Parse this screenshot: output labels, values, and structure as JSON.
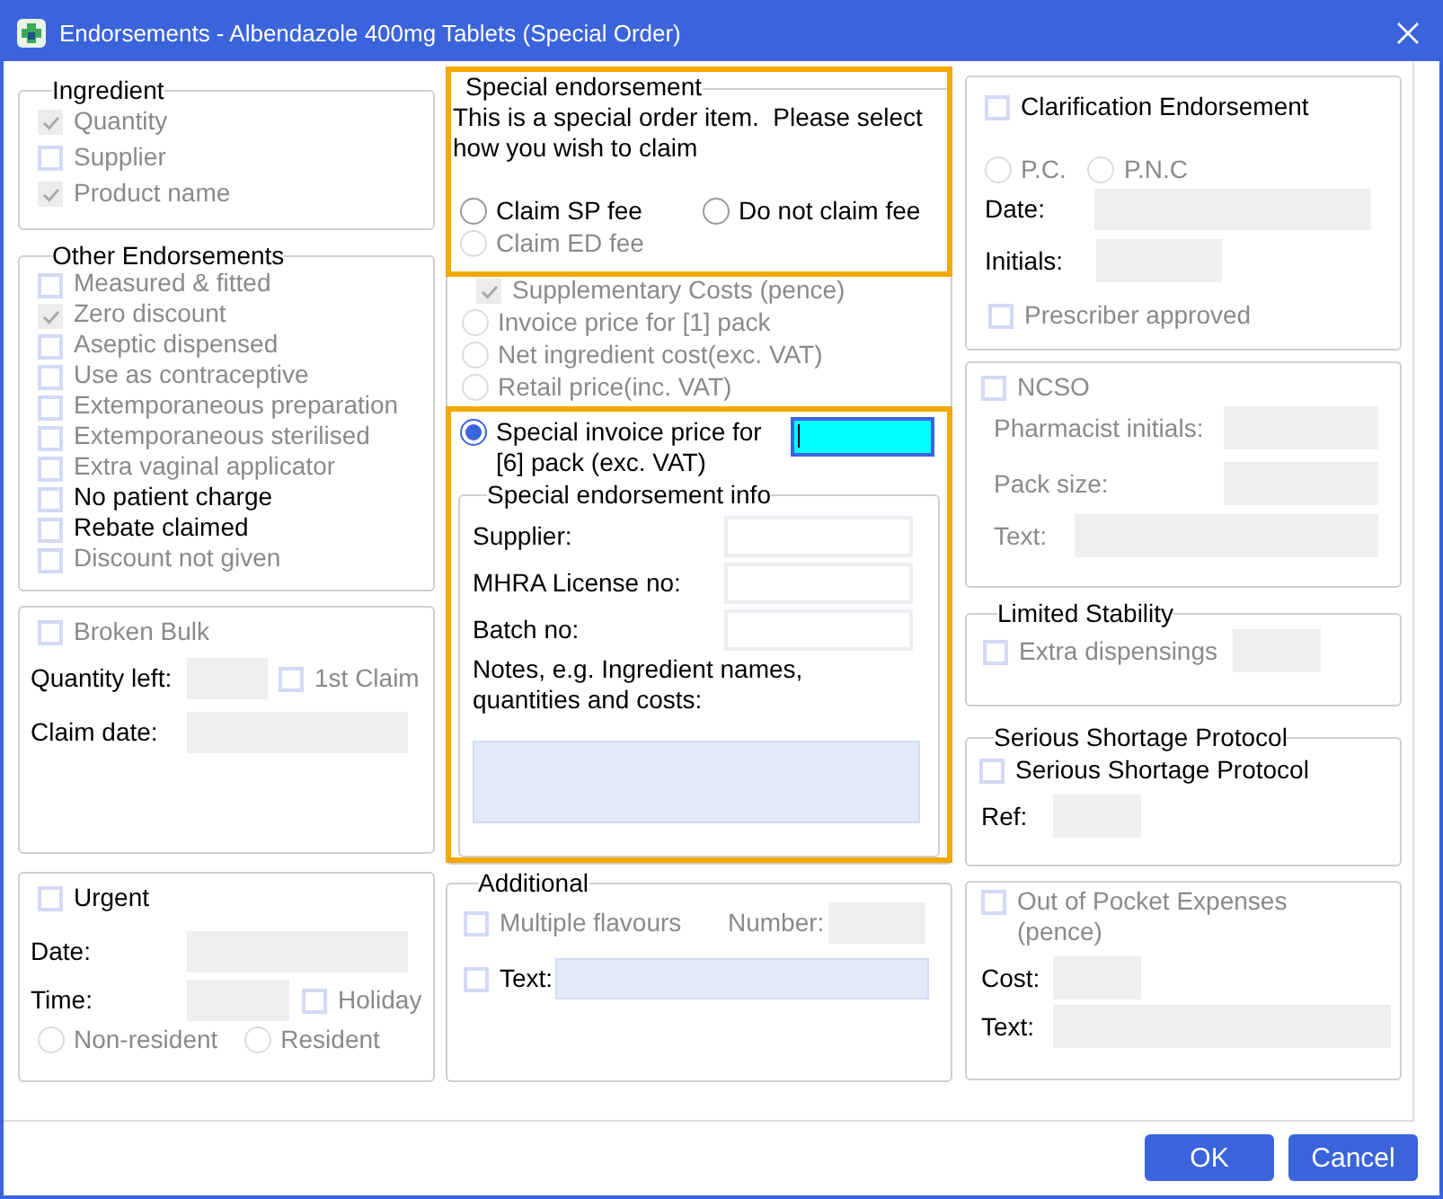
{
  "window": {
    "title": "Endorsements - Albendazole 400mg Tablets (Special Order)"
  },
  "ingredient": {
    "legend": "Ingredient",
    "options": [
      {
        "label": "Quantity",
        "checked": true,
        "disabled": true
      },
      {
        "label": "Supplier",
        "checked": false,
        "disabled": true
      },
      {
        "label": "Product name",
        "checked": true,
        "disabled": true
      }
    ]
  },
  "other_endorsements": {
    "legend": "Other Endorsements",
    "options": [
      {
        "label": "Measured & fitted",
        "checked": false,
        "disabled": true
      },
      {
        "label": "Zero discount",
        "checked": true,
        "disabled": true
      },
      {
        "label": "Aseptic dispensed",
        "checked": false,
        "disabled": true
      },
      {
        "label": "Use as contraceptive",
        "checked": false,
        "disabled": true
      },
      {
        "label": "Extemporaneous preparation",
        "checked": false,
        "disabled": true
      },
      {
        "label": "Extemporaneous sterilised",
        "checked": false,
        "disabled": true
      },
      {
        "label": "Extra vaginal applicator",
        "checked": false,
        "disabled": true
      },
      {
        "label": "No patient charge",
        "checked": false,
        "disabled": false
      },
      {
        "label": "Rebate claimed",
        "checked": false,
        "disabled": false
      },
      {
        "label": "Discount not given",
        "checked": false,
        "disabled": true
      }
    ]
  },
  "broken_bulk": {
    "checkbox": {
      "label": "Broken Bulk",
      "checked": false,
      "disabled": true
    },
    "quantity_left": {
      "label": "Quantity left:",
      "dimmed": false,
      "disabled": true
    },
    "first_claim": {
      "label": "1st Claim",
      "checked": false,
      "disabled": true
    },
    "claim_date": {
      "label": "Claim date:",
      "dimmed": false,
      "disabled": true
    }
  },
  "urgent": {
    "checkbox": {
      "label": "Urgent",
      "checked": false,
      "disabled": false
    },
    "date": {
      "label": "Date:",
      "dimmed": false,
      "disabled": true
    },
    "time": {
      "label": "Time:",
      "dimmed": false,
      "disabled": true
    },
    "holiday": {
      "label": "Holiday",
      "checked": false,
      "disabled": true
    },
    "residency": [
      {
        "label": "Non-resident",
        "selected": false,
        "disabled": true
      },
      {
        "label": "Resident",
        "selected": false,
        "disabled": true
      }
    ]
  },
  "special_endorsement": {
    "legend": "Special endorsement",
    "highlighted": true,
    "message": "This is a special order item.  Please select how you wish to claim",
    "options": [
      {
        "label": "Claim SP fee",
        "selected": false,
        "disabled": false
      },
      {
        "label": "Do not claim fee",
        "selected": false,
        "disabled": false
      },
      {
        "label": "Claim ED fee",
        "selected": false,
        "disabled": true
      }
    ]
  },
  "pricing": {
    "supplementary_costs": {
      "label": "Supplementary Costs (pence)",
      "checked": true,
      "disabled": true
    },
    "options": [
      {
        "label": "Invoice price for [1] pack",
        "selected": false,
        "disabled": true
      },
      {
        "label": "Net ingredient cost(exc. VAT)",
        "selected": false,
        "disabled": true
      },
      {
        "label": "Retail price(inc. VAT)",
        "selected": false,
        "disabled": true
      }
    ],
    "special_invoice": {
      "highlighted": true,
      "option": {
        "label": "Special invoice price for [6] pack (exc. VAT)",
        "selected": true,
        "disabled": false
      },
      "price_field": {
        "disabled": false,
        "focused": true
      },
      "info": {
        "legend": "Special endorsement info",
        "fields": [
          {
            "label": "Supplier:",
            "dimmed": false,
            "disabled": false,
            "read_only": true
          },
          {
            "label": "MHRA License no:",
            "dimmed": false,
            "disabled": false,
            "read_only": true
          },
          {
            "label": "Batch no:",
            "dimmed": false,
            "disabled": false,
            "read_only": true
          }
        ],
        "notes": {
          "label": "Notes, e.g. Ingredient names, quantities and costs:",
          "dimmed": false,
          "disabled": false,
          "read_only": false
        }
      }
    }
  },
  "additional": {
    "legend": "Additional",
    "multiple_flavours": {
      "label": "Multiple flavours",
      "checked": false,
      "disabled": true
    },
    "number": {
      "label": "Number:",
      "dimmed": true,
      "disabled": true
    },
    "text": {
      "checkbox": {
        "label": "Text:",
        "checked": false,
        "disabled": false
      },
      "field": {
        "disabled": false,
        "read_only": false
      }
    }
  },
  "clarification": {
    "checkbox": {
      "label": "Clarification Endorsement",
      "checked": false,
      "disabled": false
    },
    "options": [
      {
        "label": "P.C.",
        "selected": false,
        "disabled": true
      },
      {
        "label": "P.N.C",
        "selected": false,
        "disabled": true
      }
    ],
    "date": {
      "label": "Date:",
      "dimmed": false,
      "disabled": true
    },
    "initials": {
      "label": "Initials:",
      "dimmed": false,
      "disabled": true
    },
    "prescriber_approved": {
      "label": "Prescriber approved",
      "checked": false,
      "disabled": true
    }
  },
  "ncso": {
    "checkbox": {
      "label": "NCSO",
      "checked": false,
      "disabled": true
    },
    "fields": [
      {
        "label": "Pharmacist initials:",
        "dimmed": true,
        "disabled": true
      },
      {
        "label": "Pack size:",
        "dimmed": true,
        "disabled": true
      },
      {
        "label": "Text:",
        "dimmed": true,
        "disabled": true
      }
    ]
  },
  "limited_stability": {
    "legend": "Limited Stability",
    "extra_dispensings": {
      "label": "Extra dispensings",
      "checked": false,
      "disabled": true
    },
    "field": {
      "disabled": true
    }
  },
  "serious_shortage": {
    "legend": "Serious Shortage Protocol",
    "checkbox": {
      "label": "Serious Shortage Protocol",
      "checked": false,
      "disabled": false
    },
    "ref": {
      "label": "Ref:",
      "dimmed": false,
      "disabled": true
    }
  },
  "out_of_pocket": {
    "checkbox": {
      "label": "Out of Pocket Expenses (pence)",
      "checked": false,
      "disabled": true
    },
    "cost": {
      "label": "Cost:",
      "dimmed": false,
      "disabled": true
    },
    "text": {
      "label": "Text:",
      "dimmed": false,
      "disabled": true
    }
  },
  "buttons": [
    {
      "label": "OK"
    },
    {
      "label": "Cancel"
    }
  ]
}
